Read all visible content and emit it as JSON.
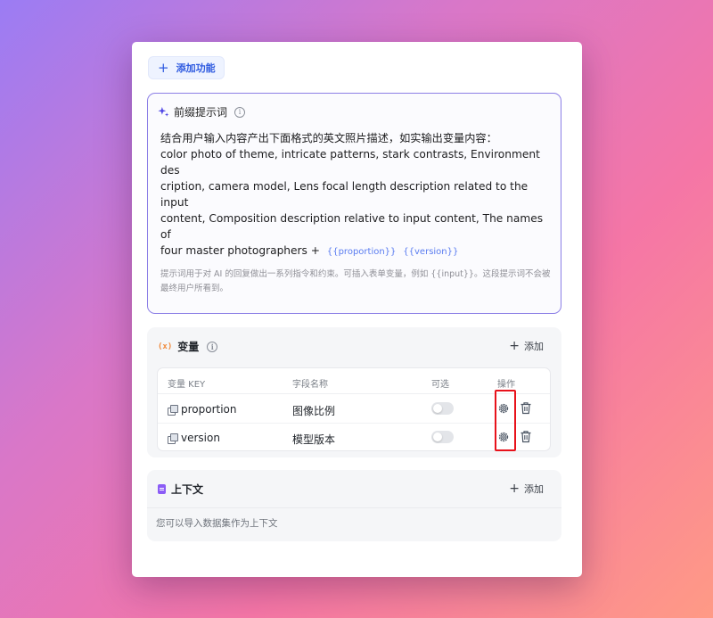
{
  "toolbar": {
    "add_feature_label": "添加功能"
  },
  "prompt": {
    "title": "前缀提示词",
    "lines": [
      "结合用户输入内容产出下面格式的英文照片描述，如实输出变量内容：",
      "color photo of theme, intricate patterns, stark contrasts, Environment des",
      "cription, camera model, Lens focal length description related to the input",
      "content, Composition description relative to input content, The names of",
      "four master photographers +"
    ],
    "chips": [
      "{{proportion}}",
      "{{version}}"
    ],
    "hint": "提示词用于对 AI 的回复做出一系列指令和约束。可插入表单变量，例如 {{input}}。这段提示词不会被最终用户所看到。"
  },
  "variables": {
    "icon": "(x)",
    "title": "变量",
    "add_label": "添加",
    "columns": [
      "变量 KEY",
      "字段名称",
      "可选",
      "操作"
    ],
    "rows": [
      {
        "key": "proportion",
        "name": "图像比例",
        "optional": false
      },
      {
        "key": "version",
        "name": "模型版本",
        "optional": false
      }
    ]
  },
  "context": {
    "title": "上下文",
    "add_label": "添加",
    "description": "您可以导入数据集作为上下文"
  },
  "colors": {
    "accent": "#2f5be0",
    "prompt_border": "#8c7fe6",
    "highlight": "#e8121b",
    "variable_icon": "#f08a3b",
    "context_icon": "#8b5cf6"
  }
}
